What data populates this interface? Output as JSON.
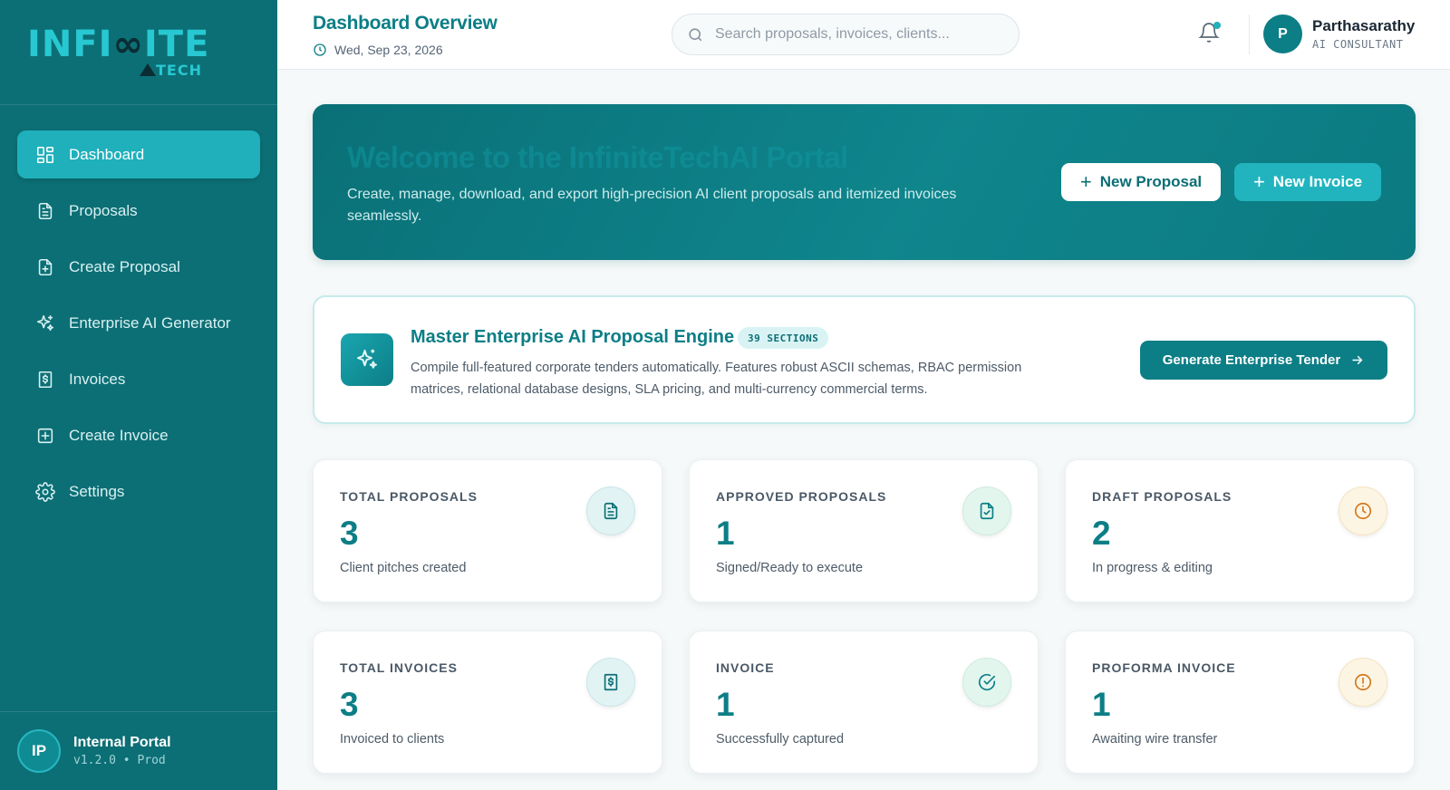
{
  "brand": {
    "logo_text_left": "INFI",
    "logo_text_mid": "∞",
    "logo_text_right": "ITE",
    "logo_sub": "TECH"
  },
  "sidebar": {
    "items": [
      {
        "label": "Dashboard",
        "icon": "grid-icon",
        "active": true
      },
      {
        "label": "Proposals",
        "icon": "document-icon"
      },
      {
        "label": "Create Proposal",
        "icon": "document-plus-icon"
      },
      {
        "label": "Enterprise AI Generator",
        "icon": "sparkles-icon"
      },
      {
        "label": "Invoices",
        "icon": "invoice-dollar-icon"
      },
      {
        "label": "Create Invoice",
        "icon": "plus-square-icon"
      },
      {
        "label": "Settings",
        "icon": "gear-icon"
      }
    ],
    "footer": {
      "avatar": "IP",
      "title": "Internal Portal",
      "version": "v1.2.0 • Prod"
    }
  },
  "header": {
    "title": "Dashboard Overview",
    "date": "Wed, Sep 23, 2026",
    "search_placeholder": "Search proposals, invoices, clients...",
    "user": {
      "initial": "P",
      "name": "Parthasarathy",
      "role": "AI CONSULTANT"
    }
  },
  "banner": {
    "title": "Welcome to the InfiniteTechAI Portal",
    "subtitle": "Create, manage, download, and export high-precision AI client proposals and itemized invoices seamlessly.",
    "new_proposal": "New Proposal",
    "new_invoice": "New Invoice"
  },
  "engine": {
    "title": "Master Enterprise AI Proposal Engine",
    "badge": "39 SECTIONS",
    "description": "Compile full-featured corporate tenders automatically. Features robust ASCII schemas, RBAC permission matrices, relational database designs, SLA pricing, and multi-currency commercial terms.",
    "button": "Generate Enterprise Tender"
  },
  "stats": [
    {
      "label": "TOTAL PROPOSALS",
      "value": "3",
      "desc": "Client pitches created",
      "icon": "document-icon",
      "tone": "teal"
    },
    {
      "label": "APPROVED PROPOSALS",
      "value": "1",
      "desc": "Signed/Ready to execute",
      "icon": "document-check-icon",
      "tone": "green"
    },
    {
      "label": "DRAFT PROPOSALS",
      "value": "2",
      "desc": "In progress & editing",
      "icon": "clock-icon",
      "tone": "amber"
    },
    {
      "label": "TOTAL INVOICES",
      "value": "3",
      "desc": "Invoiced to clients",
      "icon": "invoice-dollar-icon",
      "tone": "teal"
    },
    {
      "label": "INVOICE",
      "value": "1",
      "desc": "Successfully captured",
      "icon": "check-circle-icon",
      "tone": "green"
    },
    {
      "label": "PROFORMA INVOICE",
      "value": "1",
      "desc": "Awaiting wire transfer",
      "icon": "alert-circle-icon",
      "tone": "amber"
    }
  ],
  "colors": {
    "primary": "#0c7e86",
    "sidebar": "#0c6f75",
    "accent": "#1fb0bb",
    "amber": "#d3781e"
  }
}
